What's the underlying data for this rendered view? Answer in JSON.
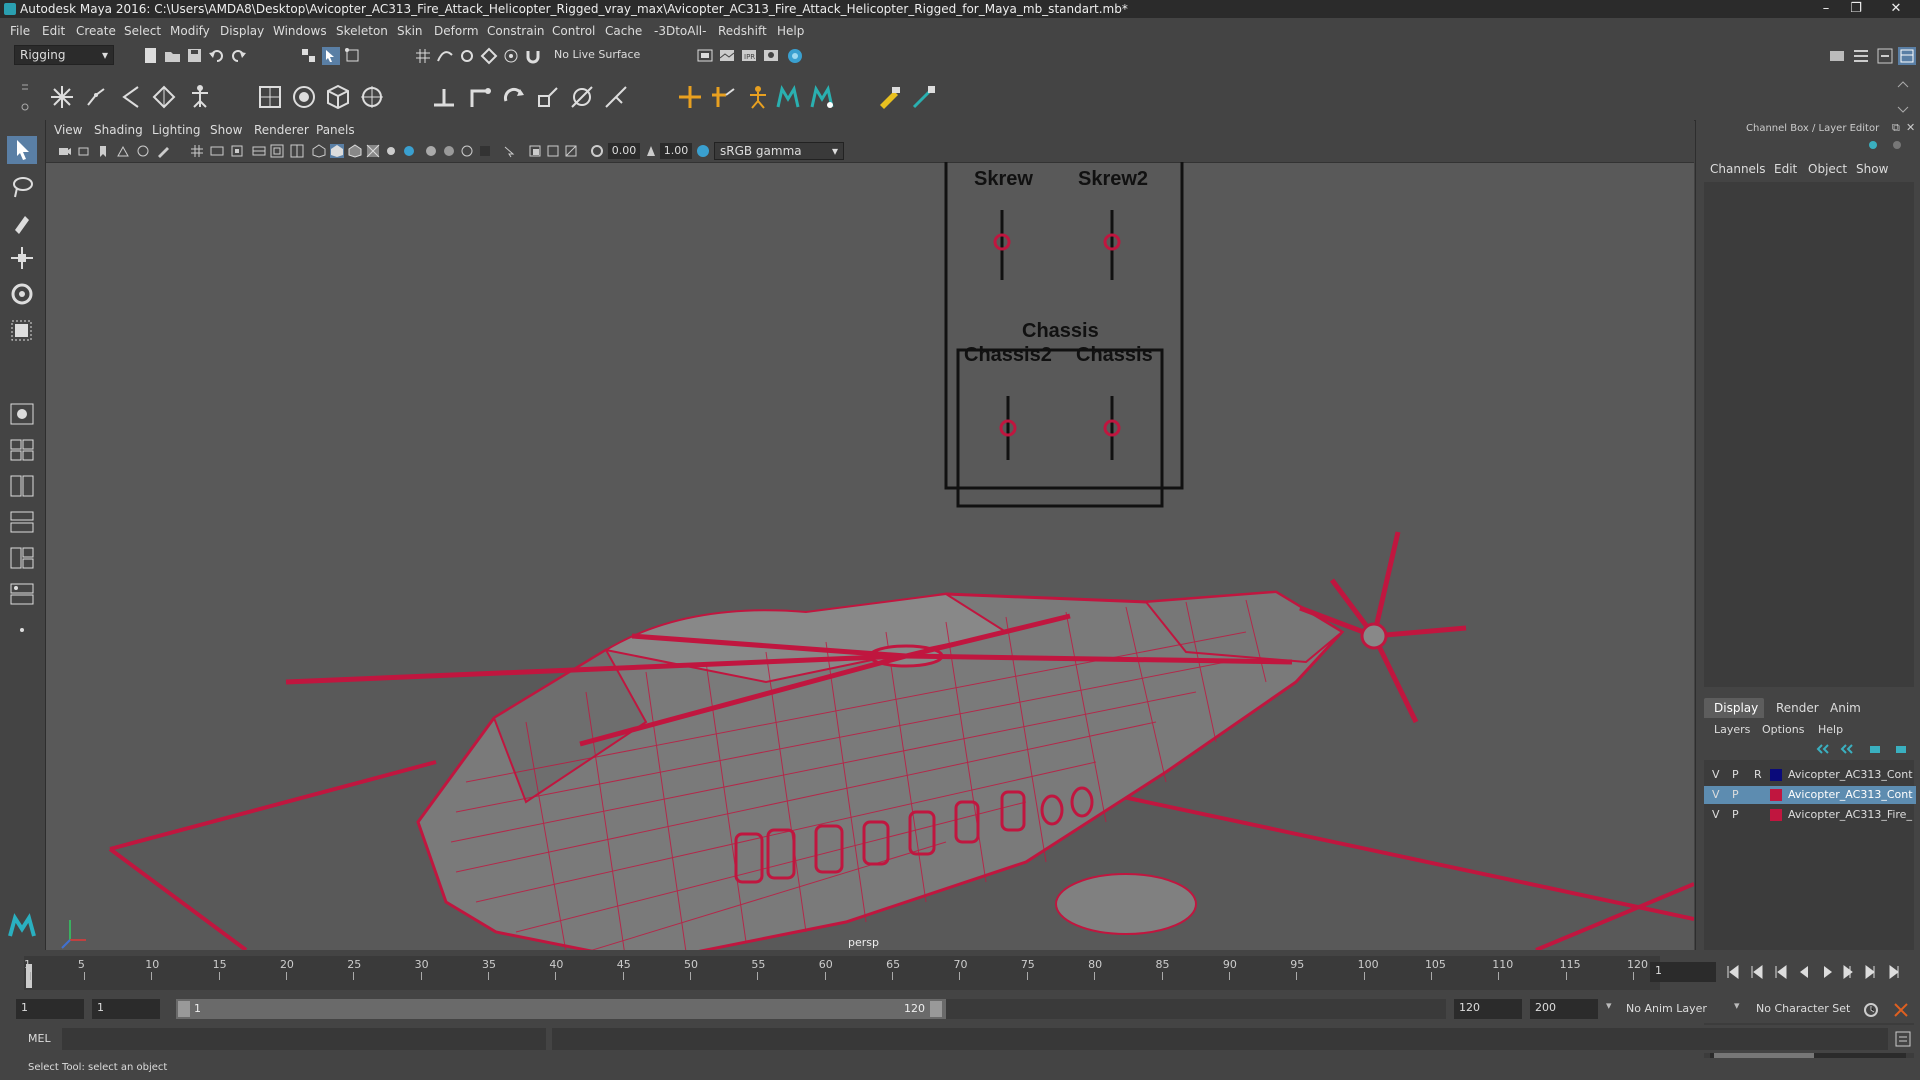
{
  "window": {
    "title": "Autodesk Maya 2016: C:\\Users\\AMDA8\\Desktop\\Avicopter_AC313_Fire_Attack_Helicopter_Rigged_vray_max\\Avicopter_AC313_Fire_Attack_Helicopter_Rigged_for_Maya_mb_standart.mb*",
    "minimize": "–",
    "maximize": "❐",
    "close": "✕"
  },
  "menus": [
    "File",
    "Edit",
    "Create",
    "Select",
    "Modify",
    "Display",
    "Windows",
    "Skeleton",
    "Skin",
    "Deform",
    "Constrain",
    "Control",
    "Cache",
    "-3DtoAll-",
    "Redshift",
    "Help"
  ],
  "status_line": {
    "mode": "Rigging",
    "live_surface": "No Live Surface"
  },
  "viewport": {
    "menus": [
      "View",
      "Shading",
      "Lighting",
      "Show",
      "Renderer",
      "Panels"
    ],
    "exposure": "0.00",
    "gamma": "1.00",
    "color_space": "sRGB gamma",
    "camera_label": "persp",
    "controls": {
      "skrew": "Skrew",
      "skrew2": "Skrew2",
      "chassis_title": "Chassis",
      "chassis2": "Chassis2",
      "chassis": "Chassis"
    }
  },
  "channel_box": {
    "title": "Channel Box / Layer Editor",
    "menus": [
      "Channels",
      "Edit",
      "Object",
      "Show"
    ],
    "tabs": [
      "Display",
      "Render",
      "Anim"
    ],
    "layer_menus": [
      "Layers",
      "Options",
      "Help"
    ],
    "layers": [
      {
        "v": "V",
        "p": "P",
        "r": "R",
        "color": "#0a0a7a",
        "name": "Avicopter_AC313_Cont",
        "selected": false
      },
      {
        "v": "V",
        "p": "P",
        "r": "",
        "color": "#c0163f",
        "name": "Avicopter_AC313_Cont",
        "selected": true
      },
      {
        "v": "V",
        "p": "P",
        "r": "",
        "color": "#c0163f",
        "name": "Avicopter_AC313_Fire_",
        "selected": false
      }
    ]
  },
  "timeline": {
    "ticks": [
      "1",
      "5",
      "10",
      "15",
      "20",
      "25",
      "30",
      "35",
      "40",
      "45",
      "50",
      "55",
      "60",
      "65",
      "70",
      "75",
      "80",
      "85",
      "90",
      "95",
      "100",
      "105",
      "110",
      "115",
      "120"
    ],
    "current_frame": "1"
  },
  "range": {
    "start": "1",
    "playback_start": "1",
    "slider_start": "1",
    "slider_end": "120",
    "playback_end": "120",
    "end": "200",
    "anim_layer": "No Anim Layer",
    "character_set": "No Character Set"
  },
  "command_line": {
    "language": "MEL"
  },
  "help_line": "Select Tool: select an object",
  "colors": {
    "wire": "#c0163f",
    "accent": "#4aa3c8"
  }
}
